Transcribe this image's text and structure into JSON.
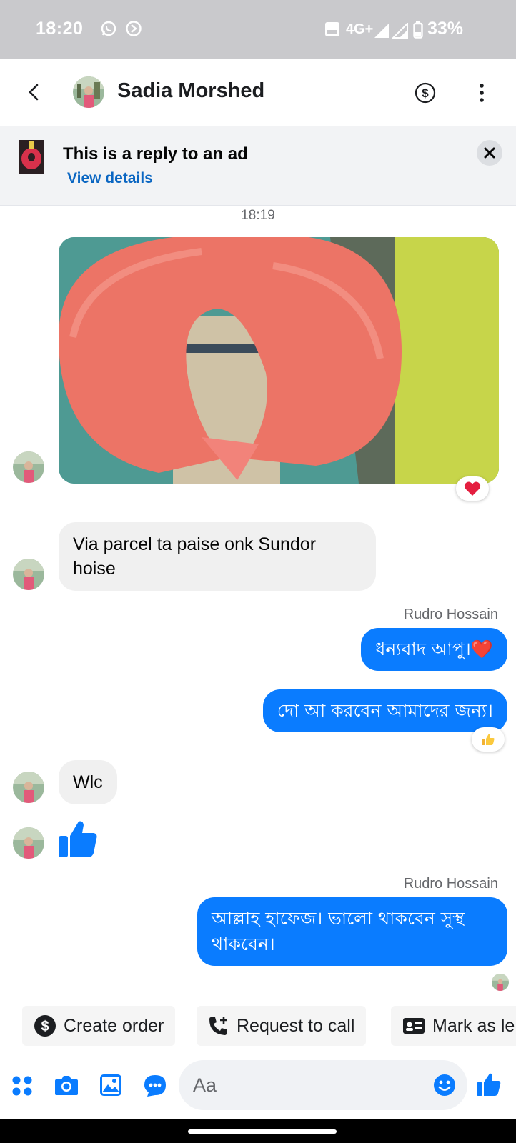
{
  "status_bar": {
    "time": "18:20",
    "network": "4G+",
    "battery": "33%"
  },
  "header": {
    "contact_name": "Sadia Morshed"
  },
  "ad_banner": {
    "title": "This is a reply to an ad",
    "link": "View details"
  },
  "conversation": {
    "timestamp": "18:19",
    "messages": [
      {
        "text": "Via parcel ta paise onk Sundor hoise"
      },
      {
        "sender": "Rudro Hossain",
        "text": "ধন্যবাদ আপু।❤️"
      },
      {
        "text": "দো আ করবেন আমাদের জন্য।"
      },
      {
        "text": "Wlc"
      },
      {
        "sender": "Rudro Hossain",
        "text": "আল্লাহ হাফেজ। ভালো থাকবেন সুস্থ থাকবেন।"
      }
    ],
    "reactions": {
      "photo": "❤️",
      "dua_message": "👍"
    }
  },
  "quick_actions": {
    "create_order": "Create order",
    "request_call": "Request to call",
    "mark_as": "Mark as le"
  },
  "composer": {
    "placeholder": "Aa"
  },
  "colors": {
    "accent": "#0a7cff",
    "status_bar_bg": "#c9c9cc"
  }
}
